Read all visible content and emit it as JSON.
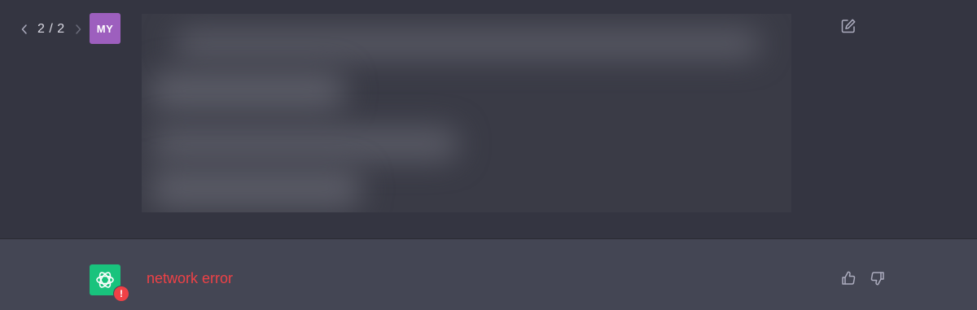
{
  "user_message": {
    "pager": {
      "prev_icon": "chevron-left-icon",
      "counter": "2 / 2",
      "next_icon": "chevron-right-icon"
    },
    "avatar_initials": "MY",
    "avatar_color": "#9d5fbe",
    "content": "",
    "content_blurred": true,
    "edit_icon": "edit-icon"
  },
  "assistant_message": {
    "avatar_icon": "openai-logo-icon",
    "avatar_color": "#19c37d",
    "error_badge": "!",
    "error_text": "network error",
    "error_color": "#ef4146",
    "feedback": {
      "thumbs_up_icon": "thumbs-up-icon",
      "thumbs_down_icon": "thumbs-down-icon"
    }
  },
  "colors": {
    "background": "#343541",
    "assistant_background": "#444654",
    "icon_color": "#acacbe"
  }
}
